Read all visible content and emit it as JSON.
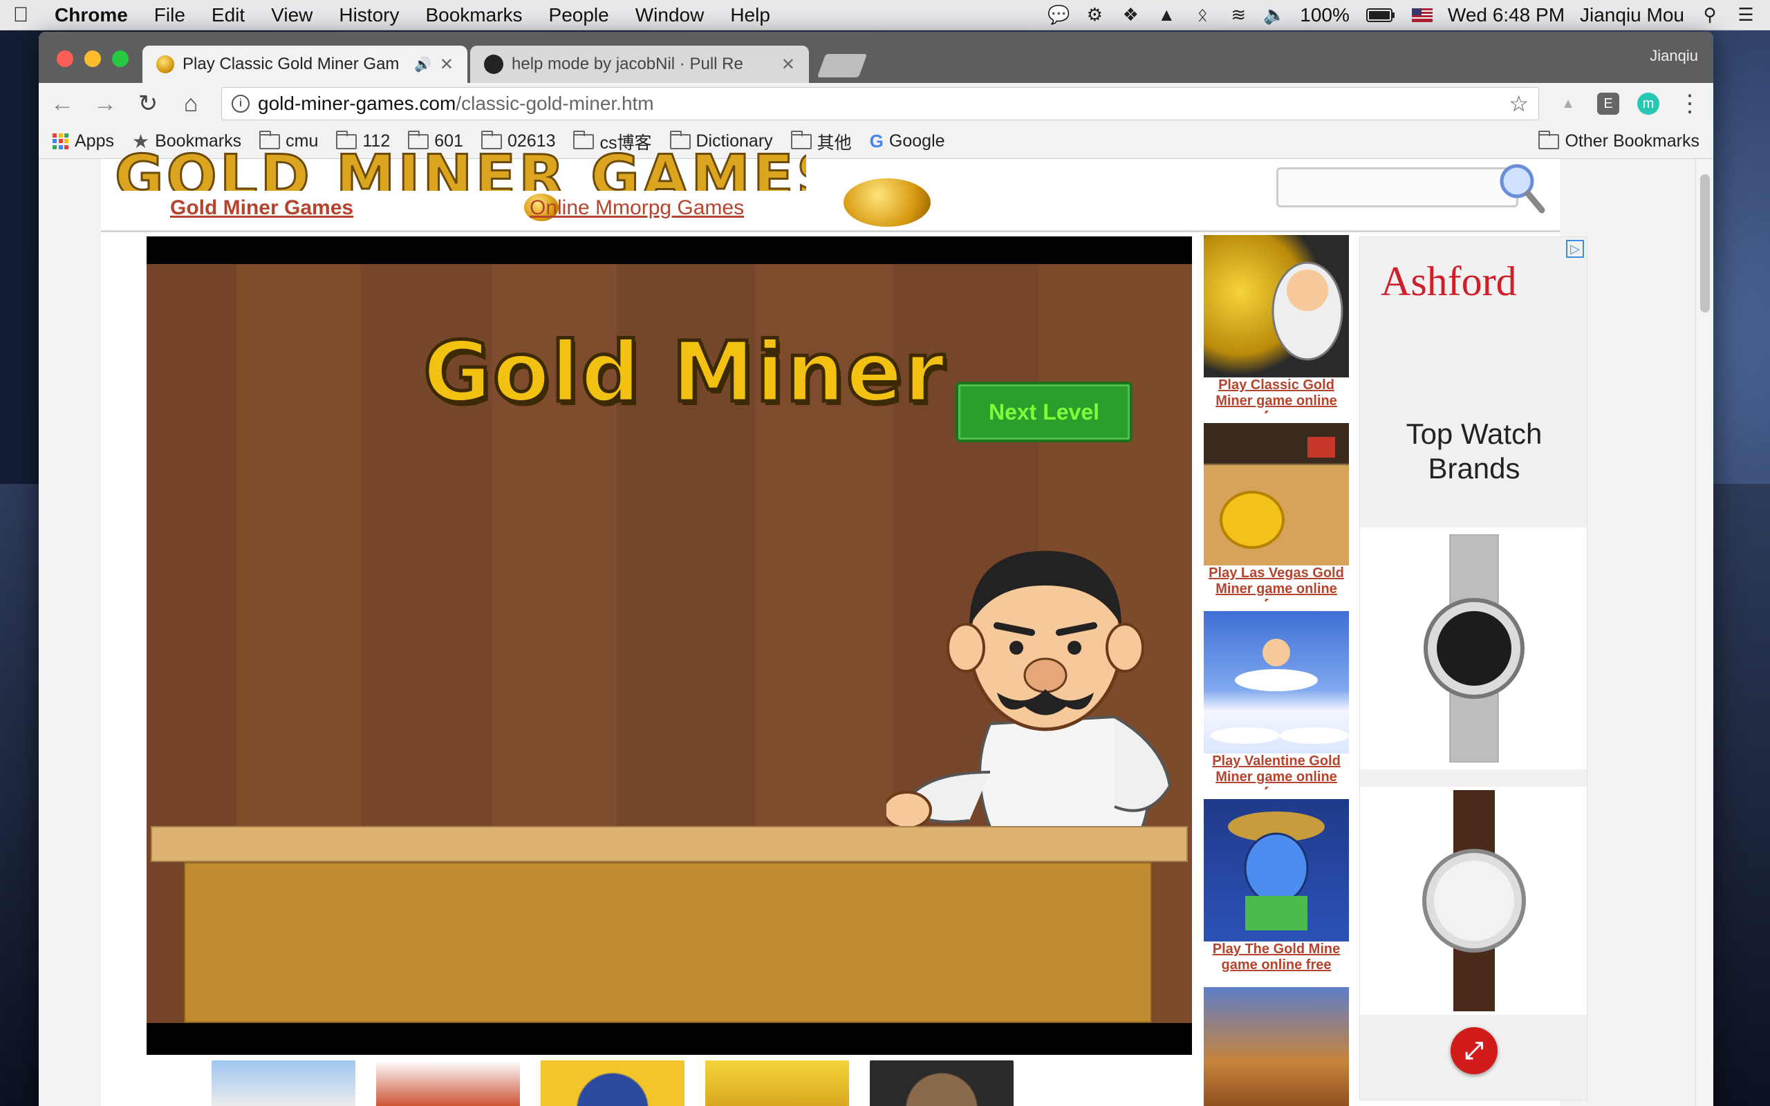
{
  "menubar": {
    "app": "Chrome",
    "items": [
      "File",
      "Edit",
      "View",
      "History",
      "Bookmarks",
      "People",
      "Window",
      "Help"
    ],
    "battery": "100%",
    "clock": "Wed 6:48 PM",
    "user": "Jianqiu Mou"
  },
  "browser": {
    "profile_name": "Jianqiu",
    "tabs": [
      {
        "title": "Play Classic Gold Miner Gam"
      },
      {
        "title": "help mode by jacobNil · Pull Re"
      }
    ],
    "url_domain": "gold-miner-games.com",
    "url_path": "/classic-gold-miner.htm",
    "bookmarks": [
      "Apps",
      "Bookmarks",
      "cmu",
      "112",
      "601",
      "02613",
      "cs博客",
      "Dictionary",
      "其他",
      "Google"
    ],
    "other_bookmarks": "Other Bookmarks"
  },
  "site": {
    "logo_text": "GOLD MINER GAMES",
    "nav_link_1": "Gold Miner Games",
    "nav_link_2": "Online Mmorpg Games",
    "search_placeholder": ""
  },
  "game": {
    "title": "Gold Miner",
    "next_level_label": "Next Level"
  },
  "side_games": [
    {
      "caption": "Play Classic Gold Miner game online free"
    },
    {
      "caption": "Play Las Vegas Gold Miner game online free"
    },
    {
      "caption": "Play Valentine Gold Miner game online free"
    },
    {
      "caption": "Play The Gold Mine game online free"
    }
  ],
  "ad": {
    "brand": "Ashford",
    "headline_line1": "Top Watch",
    "headline_line2": "Brands"
  },
  "colors": {
    "link": "#b5432d",
    "game_bg": "#7b4a2a",
    "next_button": "#2b9f2b",
    "ad_red": "#cf1f2a"
  }
}
